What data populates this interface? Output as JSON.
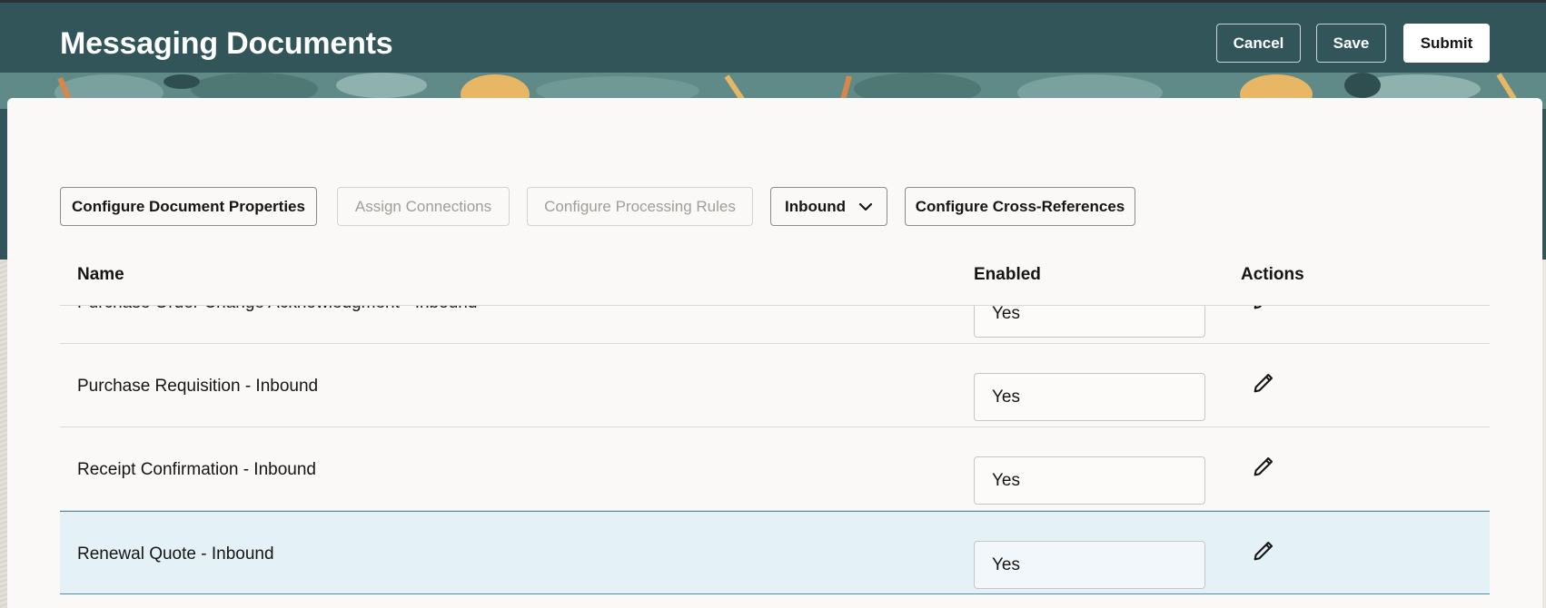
{
  "header": {
    "title": "Messaging Documents",
    "cancel_label": "Cancel",
    "save_label": "Save",
    "submit_label": "Submit"
  },
  "toolbar": {
    "configure_document_properties": "Configure Document Properties",
    "assign_connections": "Assign Connections",
    "configure_processing_rules": "Configure Processing Rules",
    "direction_select": {
      "selected": "Inbound",
      "icon": "chevron-down-icon"
    },
    "configure_cross_references": "Configure Cross-References"
  },
  "table": {
    "columns": [
      "Name",
      "Enabled",
      "Actions"
    ],
    "rows": [
      {
        "name": "Purchase Order Change Acknowledgment - Inbound",
        "enabled": "Yes",
        "action_icon": "pencil-icon"
      },
      {
        "name": "Purchase Requisition - Inbound",
        "enabled": "Yes",
        "action_icon": "pencil-icon"
      },
      {
        "name": "Receipt Confirmation - Inbound",
        "enabled": "Yes",
        "action_icon": "pencil-icon"
      },
      {
        "name": "Renewal Quote - Inbound",
        "enabled": "Yes",
        "action_icon": "pencil-icon",
        "selected": true
      }
    ]
  },
  "colors": {
    "header_bg": "#315558",
    "panel_bg": "#faf9f8",
    "selected_row_bg": "#e4f1f7",
    "selected_row_border": "#4b8cae"
  }
}
